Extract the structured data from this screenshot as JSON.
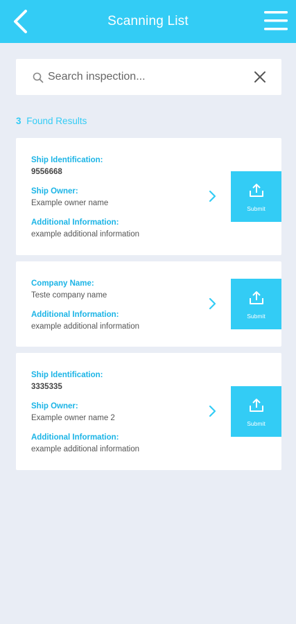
{
  "header": {
    "title": "Scanning List",
    "back_icon": "chevron-left-icon",
    "menu_icon": "hamburger-menu-icon"
  },
  "search": {
    "placeholder": "Search inspection...",
    "value": ""
  },
  "results": {
    "count": "3",
    "label": "Found Results"
  },
  "colors": {
    "accent": "#33ccf5",
    "background": "#e9edf5"
  },
  "cards": [
    {
      "fields": [
        {
          "label": "Ship Identification:",
          "value": "9556668"
        },
        {
          "label": "Ship Owner:",
          "value": "Example owner name"
        },
        {
          "label": "Additional Information:",
          "value": "example additional information"
        }
      ],
      "submit_label": "Submit"
    },
    {
      "fields": [
        {
          "label": "Company Name:",
          "value": "Teste company name"
        },
        {
          "label": "Additional Information:",
          "value": "example additional information"
        }
      ],
      "submit_label": "Submit"
    },
    {
      "fields": [
        {
          "label": "Ship Identification:",
          "value": "3335335"
        },
        {
          "label": "Ship Owner:",
          "value": "Example owner name 2"
        },
        {
          "label": "Additional Information:",
          "value": "example additional information"
        }
      ],
      "submit_label": "Submit"
    }
  ]
}
